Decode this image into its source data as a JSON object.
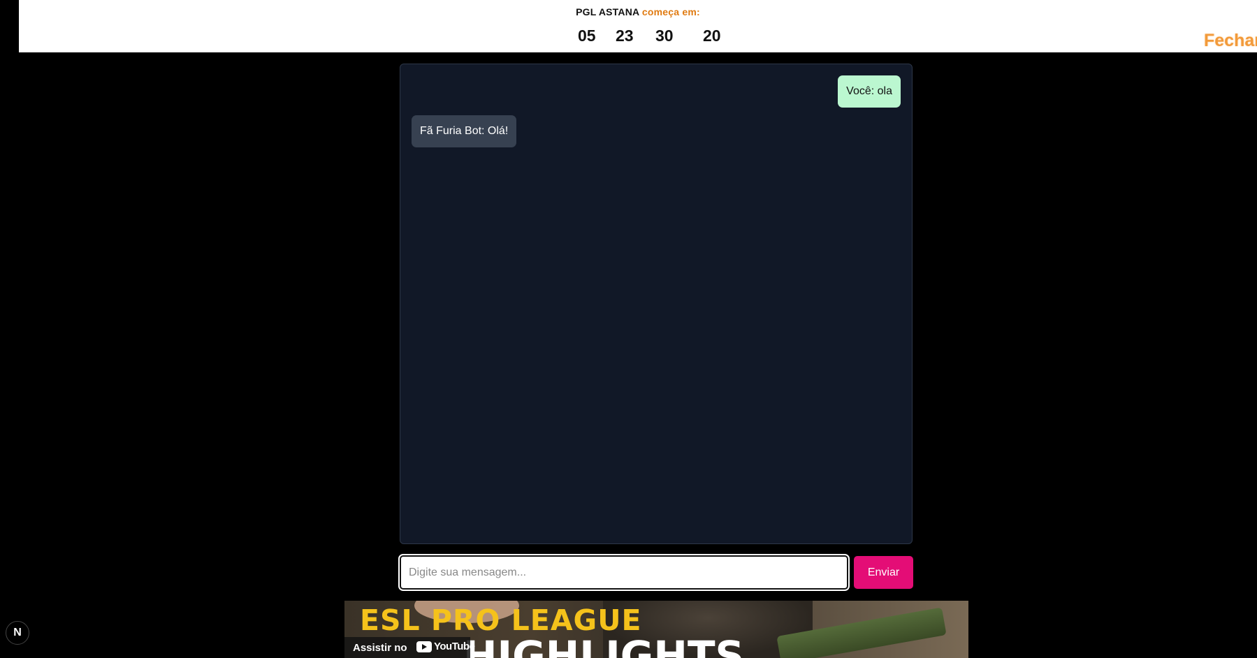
{
  "header": {
    "event_name": "PGL ASTANA",
    "event_suffix": "começa em:",
    "countdown": {
      "days": "05",
      "hours": "23",
      "minutes": "30",
      "seconds": "20"
    },
    "close_label": "Fechar"
  },
  "chat": {
    "messages": [
      {
        "sender": "user",
        "text": "Você: ola"
      },
      {
        "sender": "bot",
        "text": "Fã Furia Bot: Olá!"
      }
    ]
  },
  "composer": {
    "placeholder": "Digite sua mensagem...",
    "value": "",
    "send_label": "Enviar"
  },
  "banner": {
    "title": "ESL PRO LEAGUE",
    "subtitle": "HIGHLIGHTS",
    "watch_label": "Assistir no",
    "platform": "YouTube"
  },
  "dev_badge": {
    "label": "N"
  },
  "colors": {
    "accent_orange": "#e07b12",
    "panel_bg": "#111827",
    "user_bubble": "#bbf7d0",
    "bot_bubble": "#374151",
    "send_button": "#e40d76",
    "banner_title": "#f5c21b"
  }
}
